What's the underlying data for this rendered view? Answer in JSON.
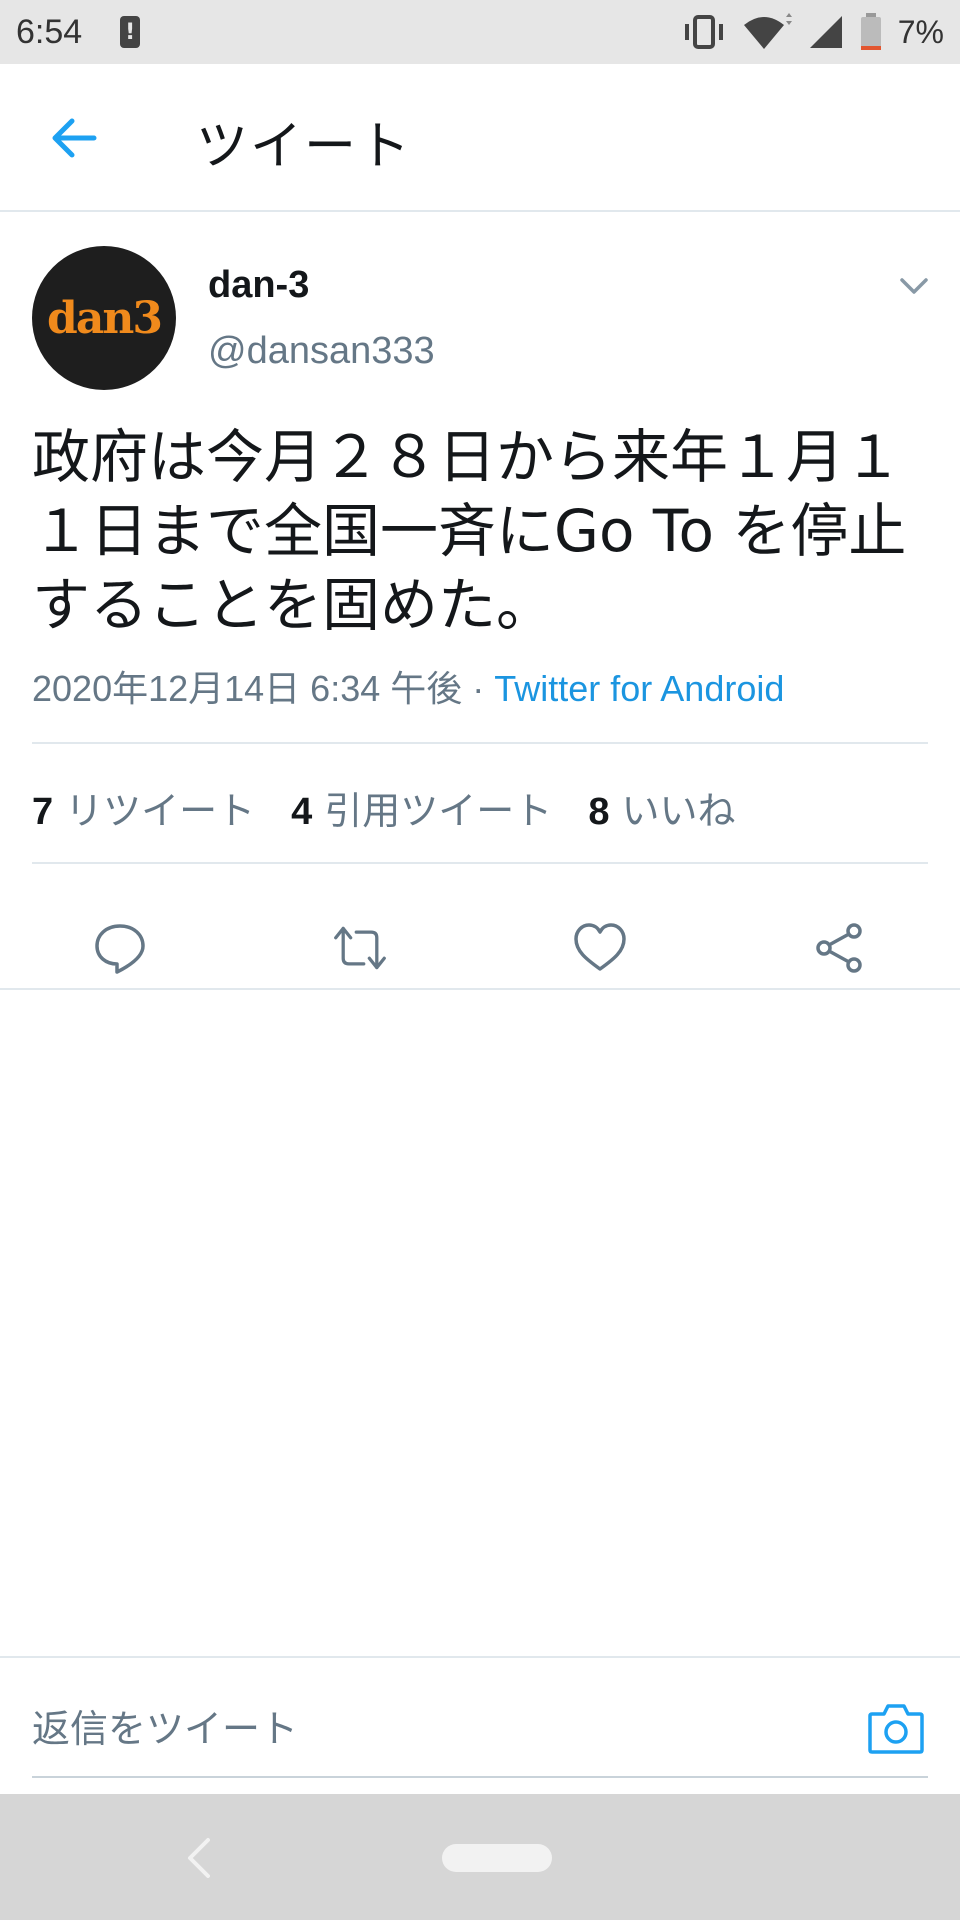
{
  "status_bar": {
    "time": "6:54",
    "battery_percent": "7%",
    "icons": [
      "alert-icon",
      "vibrate-icon",
      "wifi-icon",
      "signal-icon",
      "battery-icon"
    ]
  },
  "header": {
    "title": "ツイート",
    "back_icon": "arrow-left-icon"
  },
  "tweet": {
    "avatar_text": "dan3",
    "display_name": "dan-3",
    "handle": "@dansan333",
    "text": "政府は今月２８日から来年１月１１日まで全国一斉にGo To を停止することを固めた。",
    "timestamp": "2020年12月14日 6:34 午後",
    "separator": " · ",
    "source": "Twitter for Android",
    "stats": [
      {
        "count": "7",
        "label": "リツイート"
      },
      {
        "count": "4",
        "label": "引用ツイート"
      },
      {
        "count": "8",
        "label": "いいね"
      }
    ],
    "actions": [
      "reply-icon",
      "retweet-icon",
      "like-icon",
      "share-icon"
    ]
  },
  "reply": {
    "placeholder": "返信をツイート"
  },
  "colors": {
    "accent": "#1da1f2",
    "secondary_text": "#657786",
    "border": "#e1e8ed",
    "avatar_text": "#f08a1c"
  }
}
